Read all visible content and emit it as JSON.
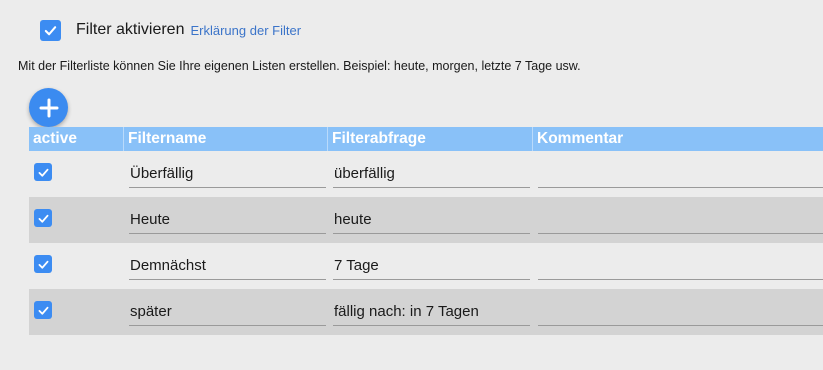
{
  "filter_toggle": {
    "label": "Filter aktivieren",
    "checked": true,
    "explain_link": "Erklärung der Filter"
  },
  "description": "Mit der Filterliste können Sie Ihre eigenen Listen erstellen. Beispiel: heute, morgen, letzte 7 Tage usw.",
  "add_button": {
    "icon": "plus-icon"
  },
  "table": {
    "columns": [
      "active",
      "Filtername",
      "Filterabfrage",
      "Kommentar"
    ],
    "rows": [
      {
        "active": true,
        "name": "Überfällig",
        "query": "überfällig",
        "comment": ""
      },
      {
        "active": true,
        "name": "Heute",
        "query": "heute",
        "comment": ""
      },
      {
        "active": true,
        "name": "Demnächst",
        "query": "7 Tage",
        "comment": ""
      },
      {
        "active": true,
        "name": "später",
        "query": "fällig nach: in 7 Tagen",
        "comment": ""
      }
    ]
  },
  "colors": {
    "accent": "#3c8cf2",
    "header_bg": "#89c1f8",
    "alt_row_bg": "#d3d3d3",
    "link": "#3b74c9"
  }
}
